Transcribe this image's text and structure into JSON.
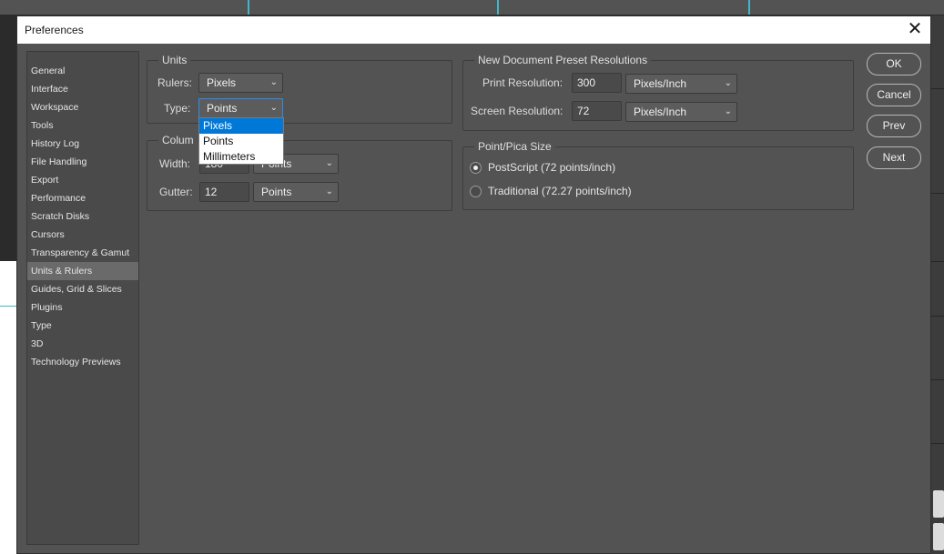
{
  "dialog": {
    "title": "Preferences",
    "close_icon": "close-icon"
  },
  "sidebar": {
    "items": [
      {
        "label": "General"
      },
      {
        "label": "Interface"
      },
      {
        "label": "Workspace"
      },
      {
        "label": "Tools"
      },
      {
        "label": "History Log"
      },
      {
        "label": "File Handling"
      },
      {
        "label": "Export"
      },
      {
        "label": "Performance"
      },
      {
        "label": "Scratch Disks"
      },
      {
        "label": "Cursors"
      },
      {
        "label": "Transparency & Gamut"
      },
      {
        "label": "Units & Rulers",
        "active": true
      },
      {
        "label": "Guides, Grid & Slices"
      },
      {
        "label": "Plugins"
      },
      {
        "label": "Type"
      },
      {
        "label": "3D"
      },
      {
        "label": "Technology Previews"
      }
    ]
  },
  "units": {
    "title": "Units",
    "rulers_label": "Rulers:",
    "rulers_value": "Pixels",
    "type_label": "Type:",
    "type_value": "Points",
    "type_options": [
      "Pixels",
      "Points",
      "Millimeters"
    ],
    "type_highlighted": "Pixels"
  },
  "columns": {
    "title": "Colum",
    "width_label": "Width:",
    "width_value": "180",
    "width_unit": "Points",
    "gutter_label": "Gutter:",
    "gutter_value": "12",
    "gutter_unit": "Points"
  },
  "resolutions": {
    "title": "New Document Preset Resolutions",
    "print_label": "Print Resolution:",
    "print_value": "300",
    "print_unit": "Pixels/Inch",
    "screen_label": "Screen Resolution:",
    "screen_value": "72",
    "screen_unit": "Pixels/Inch"
  },
  "pica": {
    "title": "Point/Pica Size",
    "postscript_label": "PostScript (72 points/inch)",
    "traditional_label": "Traditional (72.27 points/inch)",
    "selected": "postscript"
  },
  "buttons": {
    "ok": "OK",
    "cancel": "Cancel",
    "prev": "Prev",
    "next": "Next"
  },
  "colors": {
    "dialog_bg": "#535353",
    "accent_blue": "#0078d7",
    "focus_border": "#2d8ceb",
    "guide_cyan": "#3fb8c9"
  }
}
